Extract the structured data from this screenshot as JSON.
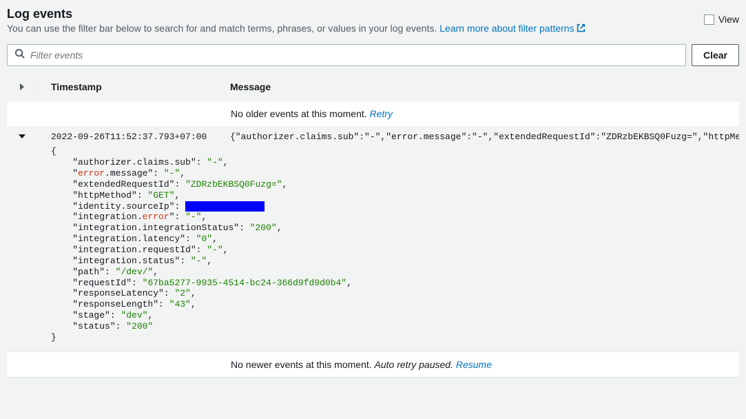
{
  "header": {
    "title": "Log events",
    "subtitle": "You can use the filter bar below to search for and match terms, phrases, or values in your log events. ",
    "learn_link": "Learn more about filter patterns",
    "view_label": "View"
  },
  "filter": {
    "placeholder": "Filter events",
    "clear_label": "Clear"
  },
  "table": {
    "col_timestamp": "Timestamp",
    "col_message": "Message",
    "no_older": "No older events at this moment. ",
    "retry": "Retry",
    "no_newer": "No newer events at this moment. ",
    "auto_paused": "Auto retry paused.",
    "resume": "Resume"
  },
  "event": {
    "timestamp": "2022-09-26T11:52:37.793+07:00",
    "message_summary": "{\"authorizer.claims.sub\":\"-\",\"error.message\":\"-\",\"extendedRequestId\":\"ZDRzbEKBSQ0Fuzg=\",\"httpMethod\":\"GET\"",
    "fields": {
      "authorizer_claims_sub": "\"-\"",
      "error_message": "\"-\"",
      "extendedRequestId": "\"ZDRzbEKBSQ0Fuzg=\"",
      "httpMethod": "\"GET\"",
      "integration_error": "\"-\"",
      "integration_integrationStatus": "\"200\"",
      "integration_latency": "\"0\"",
      "integration_requestId": "\"-\"",
      "integration_status": "\"-\"",
      "path": "\"/dev/\"",
      "requestId": "\"67ba5277-9935-4514-bc24-366d9fd9d0b4\"",
      "responseLatency": "\"2\"",
      "responseLength": "\"43\"",
      "stage": "\"dev\"",
      "status": "\"200\""
    }
  }
}
